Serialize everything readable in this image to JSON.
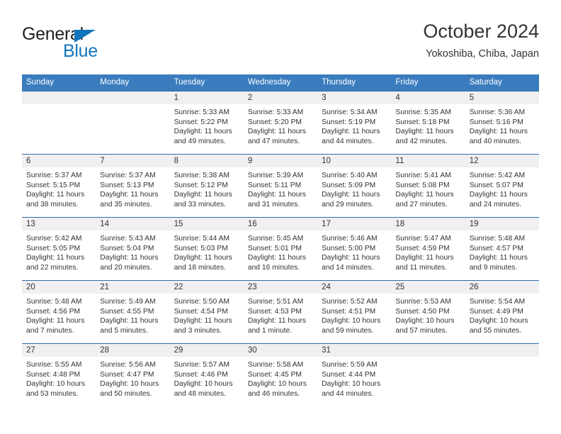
{
  "brand": {
    "name_top": "General",
    "name_bottom": "Blue",
    "triangle_color": "#1275bc",
    "text_color": "#231f20"
  },
  "header": {
    "title": "October 2024",
    "subtitle": "Yokoshiba, Chiba, Japan"
  },
  "theme": {
    "header_bg": "#3a7cbe",
    "header_text": "#ffffff",
    "row_border": "#2f6da8",
    "daynum_strip_bg": "#f0f0f0",
    "cell_bg": "#ffffff",
    "body_text": "#333333"
  },
  "weekdays": [
    "Sunday",
    "Monday",
    "Tuesday",
    "Wednesday",
    "Thursday",
    "Friday",
    "Saturday"
  ],
  "weeks": [
    [
      {
        "day": "",
        "sunrise": "",
        "sunset": "",
        "daylight_1": "",
        "daylight_2": ""
      },
      {
        "day": "",
        "sunrise": "",
        "sunset": "",
        "daylight_1": "",
        "daylight_2": ""
      },
      {
        "day": "1",
        "sunrise": "Sunrise: 5:33 AM",
        "sunset": "Sunset: 5:22 PM",
        "daylight_1": "Daylight: 11 hours",
        "daylight_2": "and 49 minutes."
      },
      {
        "day": "2",
        "sunrise": "Sunrise: 5:33 AM",
        "sunset": "Sunset: 5:20 PM",
        "daylight_1": "Daylight: 11 hours",
        "daylight_2": "and 47 minutes."
      },
      {
        "day": "3",
        "sunrise": "Sunrise: 5:34 AM",
        "sunset": "Sunset: 5:19 PM",
        "daylight_1": "Daylight: 11 hours",
        "daylight_2": "and 44 minutes."
      },
      {
        "day": "4",
        "sunrise": "Sunrise: 5:35 AM",
        "sunset": "Sunset: 5:18 PM",
        "daylight_1": "Daylight: 11 hours",
        "daylight_2": "and 42 minutes."
      },
      {
        "day": "5",
        "sunrise": "Sunrise: 5:36 AM",
        "sunset": "Sunset: 5:16 PM",
        "daylight_1": "Daylight: 11 hours",
        "daylight_2": "and 40 minutes."
      }
    ],
    [
      {
        "day": "6",
        "sunrise": "Sunrise: 5:37 AM",
        "sunset": "Sunset: 5:15 PM",
        "daylight_1": "Daylight: 11 hours",
        "daylight_2": "and 38 minutes."
      },
      {
        "day": "7",
        "sunrise": "Sunrise: 5:37 AM",
        "sunset": "Sunset: 5:13 PM",
        "daylight_1": "Daylight: 11 hours",
        "daylight_2": "and 35 minutes."
      },
      {
        "day": "8",
        "sunrise": "Sunrise: 5:38 AM",
        "sunset": "Sunset: 5:12 PM",
        "daylight_1": "Daylight: 11 hours",
        "daylight_2": "and 33 minutes."
      },
      {
        "day": "9",
        "sunrise": "Sunrise: 5:39 AM",
        "sunset": "Sunset: 5:11 PM",
        "daylight_1": "Daylight: 11 hours",
        "daylight_2": "and 31 minutes."
      },
      {
        "day": "10",
        "sunrise": "Sunrise: 5:40 AM",
        "sunset": "Sunset: 5:09 PM",
        "daylight_1": "Daylight: 11 hours",
        "daylight_2": "and 29 minutes."
      },
      {
        "day": "11",
        "sunrise": "Sunrise: 5:41 AM",
        "sunset": "Sunset: 5:08 PM",
        "daylight_1": "Daylight: 11 hours",
        "daylight_2": "and 27 minutes."
      },
      {
        "day": "12",
        "sunrise": "Sunrise: 5:42 AM",
        "sunset": "Sunset: 5:07 PM",
        "daylight_1": "Daylight: 11 hours",
        "daylight_2": "and 24 minutes."
      }
    ],
    [
      {
        "day": "13",
        "sunrise": "Sunrise: 5:42 AM",
        "sunset": "Sunset: 5:05 PM",
        "daylight_1": "Daylight: 11 hours",
        "daylight_2": "and 22 minutes."
      },
      {
        "day": "14",
        "sunrise": "Sunrise: 5:43 AM",
        "sunset": "Sunset: 5:04 PM",
        "daylight_1": "Daylight: 11 hours",
        "daylight_2": "and 20 minutes."
      },
      {
        "day": "15",
        "sunrise": "Sunrise: 5:44 AM",
        "sunset": "Sunset: 5:03 PM",
        "daylight_1": "Daylight: 11 hours",
        "daylight_2": "and 18 minutes."
      },
      {
        "day": "16",
        "sunrise": "Sunrise: 5:45 AM",
        "sunset": "Sunset: 5:01 PM",
        "daylight_1": "Daylight: 11 hours",
        "daylight_2": "and 16 minutes."
      },
      {
        "day": "17",
        "sunrise": "Sunrise: 5:46 AM",
        "sunset": "Sunset: 5:00 PM",
        "daylight_1": "Daylight: 11 hours",
        "daylight_2": "and 14 minutes."
      },
      {
        "day": "18",
        "sunrise": "Sunrise: 5:47 AM",
        "sunset": "Sunset: 4:59 PM",
        "daylight_1": "Daylight: 11 hours",
        "daylight_2": "and 11 minutes."
      },
      {
        "day": "19",
        "sunrise": "Sunrise: 5:48 AM",
        "sunset": "Sunset: 4:57 PM",
        "daylight_1": "Daylight: 11 hours",
        "daylight_2": "and 9 minutes."
      }
    ],
    [
      {
        "day": "20",
        "sunrise": "Sunrise: 5:48 AM",
        "sunset": "Sunset: 4:56 PM",
        "daylight_1": "Daylight: 11 hours",
        "daylight_2": "and 7 minutes."
      },
      {
        "day": "21",
        "sunrise": "Sunrise: 5:49 AM",
        "sunset": "Sunset: 4:55 PM",
        "daylight_1": "Daylight: 11 hours",
        "daylight_2": "and 5 minutes."
      },
      {
        "day": "22",
        "sunrise": "Sunrise: 5:50 AM",
        "sunset": "Sunset: 4:54 PM",
        "daylight_1": "Daylight: 11 hours",
        "daylight_2": "and 3 minutes."
      },
      {
        "day": "23",
        "sunrise": "Sunrise: 5:51 AM",
        "sunset": "Sunset: 4:53 PM",
        "daylight_1": "Daylight: 11 hours",
        "daylight_2": "and 1 minute."
      },
      {
        "day": "24",
        "sunrise": "Sunrise: 5:52 AM",
        "sunset": "Sunset: 4:51 PM",
        "daylight_1": "Daylight: 10 hours",
        "daylight_2": "and 59 minutes."
      },
      {
        "day": "25",
        "sunrise": "Sunrise: 5:53 AM",
        "sunset": "Sunset: 4:50 PM",
        "daylight_1": "Daylight: 10 hours",
        "daylight_2": "and 57 minutes."
      },
      {
        "day": "26",
        "sunrise": "Sunrise: 5:54 AM",
        "sunset": "Sunset: 4:49 PM",
        "daylight_1": "Daylight: 10 hours",
        "daylight_2": "and 55 minutes."
      }
    ],
    [
      {
        "day": "27",
        "sunrise": "Sunrise: 5:55 AM",
        "sunset": "Sunset: 4:48 PM",
        "daylight_1": "Daylight: 10 hours",
        "daylight_2": "and 53 minutes."
      },
      {
        "day": "28",
        "sunrise": "Sunrise: 5:56 AM",
        "sunset": "Sunset: 4:47 PM",
        "daylight_1": "Daylight: 10 hours",
        "daylight_2": "and 50 minutes."
      },
      {
        "day": "29",
        "sunrise": "Sunrise: 5:57 AM",
        "sunset": "Sunset: 4:46 PM",
        "daylight_1": "Daylight: 10 hours",
        "daylight_2": "and 48 minutes."
      },
      {
        "day": "30",
        "sunrise": "Sunrise: 5:58 AM",
        "sunset": "Sunset: 4:45 PM",
        "daylight_1": "Daylight: 10 hours",
        "daylight_2": "and 46 minutes."
      },
      {
        "day": "31",
        "sunrise": "Sunrise: 5:59 AM",
        "sunset": "Sunset: 4:44 PM",
        "daylight_1": "Daylight: 10 hours",
        "daylight_2": "and 44 minutes."
      },
      {
        "day": "",
        "sunrise": "",
        "sunset": "",
        "daylight_1": "",
        "daylight_2": ""
      },
      {
        "day": "",
        "sunrise": "",
        "sunset": "",
        "daylight_1": "",
        "daylight_2": ""
      }
    ]
  ]
}
